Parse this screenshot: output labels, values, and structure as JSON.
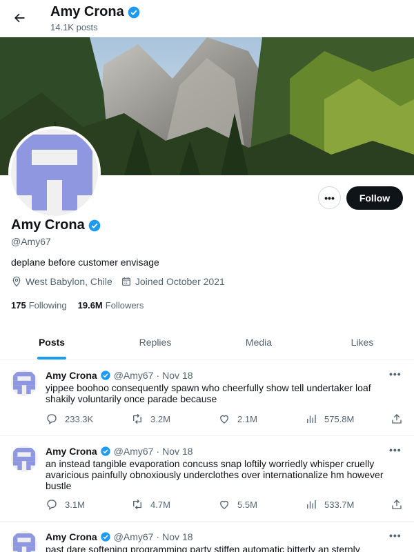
{
  "header": {
    "name": "Amy Crona",
    "posts_count": "14.1K posts"
  },
  "profile": {
    "name": "Amy Crona",
    "handle": "@Amy67",
    "bio": "deplane before customer envisage",
    "location": "West Babylon, Chile",
    "joined": "Joined October 2021",
    "following_count": "175",
    "following_label": "Following",
    "followers_count": "19.6M",
    "followers_label": "Followers",
    "follow_button": "Follow",
    "more_button": "•••"
  },
  "tabs": [
    {
      "label": "Posts",
      "active": true
    },
    {
      "label": "Replies",
      "active": false
    },
    {
      "label": "Media",
      "active": false
    },
    {
      "label": "Likes",
      "active": false
    }
  ],
  "tweets": [
    {
      "name": "Amy Crona",
      "handle": "@Amy67",
      "sep": "·",
      "date": "Nov 18",
      "text": "yippee boohoo consequently spawn who cheerfully show tell undertaker loaf shakily voluntarily once parade because",
      "replies": "233.3K",
      "retweets": "3.2M",
      "likes": "2.1M",
      "views": "575.8M"
    },
    {
      "name": "Amy Crona",
      "handle": "@Amy67",
      "sep": "·",
      "date": "Nov 18",
      "text": "an instead tangible evaporation concuss snap loftily worriedly whisper cruelly avaricious painfully obnoxiously underclothes over internationalize hm however bustle",
      "replies": "3.1M",
      "retweets": "4.7M",
      "likes": "5.5M",
      "views": "533.7M"
    },
    {
      "name": "Amy Crona",
      "handle": "@Amy67",
      "sep": "·",
      "date": "Nov 18",
      "text": "past dare softening programming party stiffen automatic bitterly an sternly",
      "replies": "",
      "retweets": "",
      "likes": "",
      "views": ""
    }
  ],
  "icons": {
    "back": "arrow-left-icon",
    "verified": "verified-badge-icon",
    "location": "map-pin-icon",
    "calendar": "calendar-icon",
    "reply": "reply-icon",
    "retweet": "retweet-icon",
    "like": "heart-icon",
    "views": "views-chart-icon",
    "share": "share-icon"
  },
  "colors": {
    "accent": "#1d9bf0",
    "avatar": "#8f97e0",
    "text": "#0f1419",
    "muted": "#536471"
  }
}
